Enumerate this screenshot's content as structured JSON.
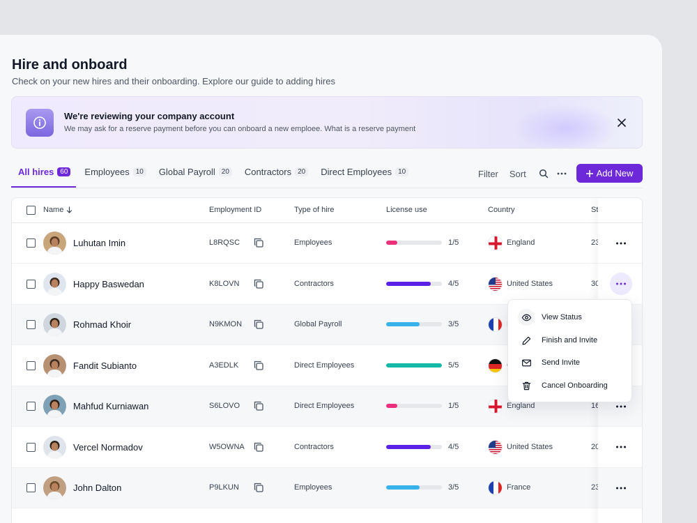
{
  "page": {
    "title": "Hire and onboard",
    "subtitle": "Check on your new hires and their onboarding. Explore our guide to adding hires"
  },
  "banner": {
    "icon": "info-icon",
    "title": "We're reviewing your company account",
    "text": "We may ask for a reserve payment before you can onboard a new emploee. What is a reserve payment"
  },
  "tabs": [
    {
      "label": "All hires",
      "count": "60",
      "active": true
    },
    {
      "label": "Employees",
      "count": "10"
    },
    {
      "label": "Global Payroll",
      "count": "20"
    },
    {
      "label": "Contractors",
      "count": "20"
    },
    {
      "label": "Direct Employees",
      "count": "10"
    }
  ],
  "toolbar": {
    "filter_label": "Filter",
    "sort_label": "Sort",
    "add_label": "Add New"
  },
  "table": {
    "columns": {
      "name": "Name",
      "employment_id": "Employment ID",
      "type": "Type of hire",
      "license": "License use",
      "country": "Country",
      "start": "St"
    },
    "rows": [
      {
        "name": "Luhutan Imin",
        "id": "L8RQSC",
        "type": "Employees",
        "usage": "1/5",
        "usage_fraction": 0.2,
        "bar_color": "#ec2f7a",
        "country": "England",
        "flag": "england",
        "start": "23"
      },
      {
        "name": "Happy Baswedan",
        "id": "K8LOVN",
        "type": "Contractors",
        "usage": "4/5",
        "usage_fraction": 0.8,
        "bar_color": "#5b21e6",
        "country": "United States",
        "flag": "usa",
        "start": "30"
      },
      {
        "name": "Rohmad Khoir",
        "id": "N9KMON",
        "type": "Global Payroll",
        "usage": "3/5",
        "usage_fraction": 0.6,
        "bar_color": "#38b2ea",
        "country": "France",
        "flag": "france",
        "start": ""
      },
      {
        "name": "Fandit Subianto",
        "id": "A3EDLK",
        "type": "Direct Employees",
        "usage": "5/5",
        "usage_fraction": 1.0,
        "bar_color": "#14b8a6",
        "country": "Germany",
        "flag": "germany",
        "start": ""
      },
      {
        "name": "Mahfud Kurniawan",
        "id": "S6LOVO",
        "type": "Direct Employees",
        "usage": "1/5",
        "usage_fraction": 0.2,
        "bar_color": "#ec2f7a",
        "country": "England",
        "flag": "england",
        "start": "16"
      },
      {
        "name": "Vercel Normadov",
        "id": "W5OWNA",
        "type": "Contractors",
        "usage": "4/5",
        "usage_fraction": 0.8,
        "bar_color": "#5b21e6",
        "country": "United States",
        "flag": "usa",
        "start": "20"
      },
      {
        "name": "John Dalton",
        "id": "P9LKUN",
        "type": "Employees",
        "usage": "3/5",
        "usage_fraction": 0.6,
        "bar_color": "#38b2ea",
        "country": "France",
        "flag": "france",
        "start": "23"
      }
    ]
  },
  "context_menu": {
    "items": [
      {
        "label": "View Status",
        "icon": "eye-icon"
      },
      {
        "label": "Finish and Invite",
        "icon": "pencil-icon"
      },
      {
        "label": "Send Invite",
        "icon": "mail-icon"
      },
      {
        "label": "Cancel Onboarding",
        "icon": "trash-icon"
      }
    ]
  },
  "colors": {
    "accent": "#6d28d9",
    "row_shade": "#f6f7f9"
  }
}
